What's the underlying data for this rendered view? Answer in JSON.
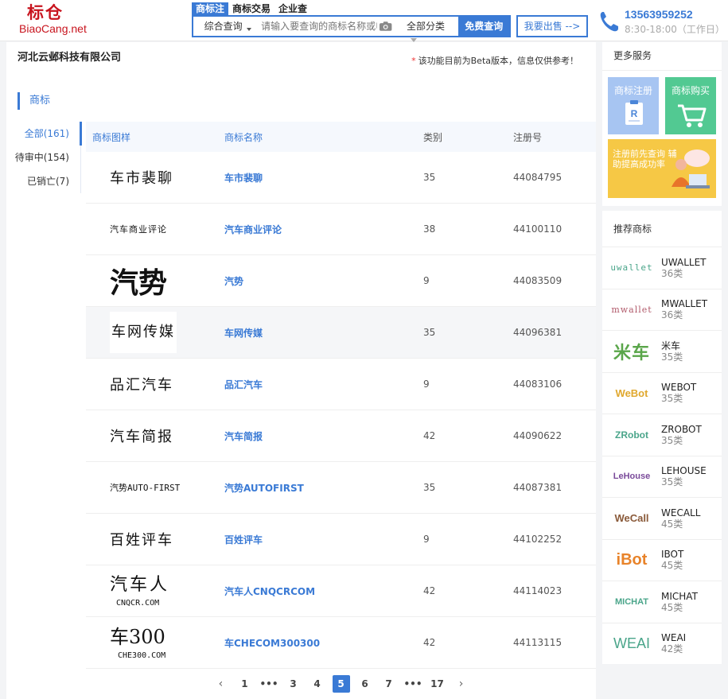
{
  "header": {
    "logo_cn": "标仓",
    "logo_en": "BiaoCang.net",
    "search_tabs": [
      "商标注",
      "商标交易",
      "企业查"
    ],
    "search_type": "综合查询",
    "search_placeholder": "请输入要查询的商标名称或申",
    "search_category": "全部分类",
    "search_button": "免费查询",
    "sell_button": "我要出售 -->",
    "phone": "13563959252",
    "hours": "8:30-18:00（工作日）"
  },
  "main": {
    "company": "河北云邺科技有限公司",
    "beta_note": "该功能目前为Beta版本，信息仅供参考！",
    "section_title": "商标",
    "filters": [
      "全部(161)",
      "待审中(154)",
      "已销亡(7)"
    ],
    "columns": [
      "商标图样",
      "商标名称",
      "类别",
      "注册号"
    ],
    "rows": [
      {
        "mark": "车市裴聊",
        "name": "车市裴聊",
        "class": "35",
        "reg": "44084795"
      },
      {
        "mark": "汽车商业评论",
        "name": "汽车商业评论",
        "class": "38",
        "reg": "44100110"
      },
      {
        "mark": "汽势",
        "name": "汽势",
        "class": "9",
        "reg": "44083509"
      },
      {
        "mark": "车网传媒",
        "name": "车网传媒",
        "class": "35",
        "reg": "44096381"
      },
      {
        "mark": "品汇汽车",
        "name": "品汇汽车",
        "class": "9",
        "reg": "44083106"
      },
      {
        "mark": "汽车简报",
        "name": "汽车简报",
        "class": "42",
        "reg": "44090622"
      },
      {
        "mark": "汽势AUTO-FIRST",
        "name": "汽势AUTOFIRST",
        "class": "35",
        "reg": "44087381"
      },
      {
        "mark": "百姓评车",
        "name": "百姓评车",
        "class": "9",
        "reg": "44102252"
      },
      {
        "mark": "汽车人",
        "mark_sub": "CNQCR.COM",
        "name": "汽车人CNQCRCOM",
        "class": "42",
        "reg": "44114023"
      },
      {
        "mark": "车300",
        "mark_sub": "CHE300.COM",
        "name": "车CHECOM300300",
        "class": "42",
        "reg": "44113115"
      }
    ],
    "pagination": [
      "1",
      "•••",
      "3",
      "4",
      "5",
      "6",
      "7",
      "•••",
      "17"
    ]
  },
  "sidebar": {
    "services_title": "更多服务",
    "services": [
      "商标注册",
      "商标购买"
    ],
    "wide_service": "注册前先查询 辅助提高成功率",
    "rec_title": "推荐商标",
    "recommended": [
      {
        "logo": "uwallet",
        "name": "UWALLET",
        "class": "36类",
        "color": "#4aa58a"
      },
      {
        "logo": "mwallet",
        "name": "MWALLET",
        "class": "36类",
        "color": "#b15a6b"
      },
      {
        "logo": "米车",
        "name": "米车",
        "class": "35类",
        "color": "#5aa64a"
      },
      {
        "logo": "WeBot",
        "name": "WEBOT",
        "class": "35类",
        "color": "#e0a82e"
      },
      {
        "logo": "ZRobot",
        "name": "ZROBOT",
        "class": "35类",
        "color": "#4aa58a"
      },
      {
        "logo": "LeHouse",
        "name": "LEHOUSE",
        "class": "35类",
        "color": "#7a4a9a"
      },
      {
        "logo": "WeCall",
        "name": "WECALL",
        "class": "45类",
        "color": "#8a5a3a"
      },
      {
        "logo": "iBot",
        "name": "IBOT",
        "class": "45类",
        "color": "#e8832a"
      },
      {
        "logo": "MICHAT",
        "name": "MICHAT",
        "class": "45类",
        "color": "#4aa58a"
      },
      {
        "logo": "WEAI",
        "name": "WEAI",
        "class": "42类",
        "color": "#4aa58a"
      }
    ]
  },
  "colors": {
    "accent": "#3a7ad5",
    "brand": "#c8141e"
  }
}
